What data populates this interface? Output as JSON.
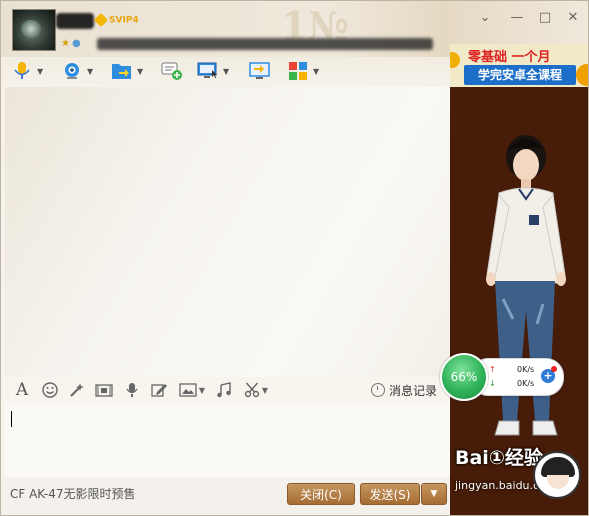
{
  "window": {
    "svip_badge": "SVIP4",
    "bg_watermark": "1№"
  },
  "toolbar": {
    "items": [
      "microphone-icon",
      "webcam-icon",
      "file-transfer-icon",
      "message-add-icon",
      "remote-desktop-icon",
      "screen-share-icon",
      "apps-icon"
    ]
  },
  "ad": {
    "line1": "零基础 一个月",
    "line2": "学完安卓全课程"
  },
  "input_toolbar": {
    "font_glyph": "A",
    "history_label": "消息记录"
  },
  "speed": {
    "percent": "66%",
    "up": "0K/s",
    "down": "0K/s",
    "plus": "+"
  },
  "footer": {
    "hint": "CF AK-47无影限时预售",
    "close_label": "关闭(C)",
    "send_label": "发送(S)"
  },
  "watermark": {
    "logo": "Bai①经验",
    "url": "jingyan.baidu.com"
  }
}
